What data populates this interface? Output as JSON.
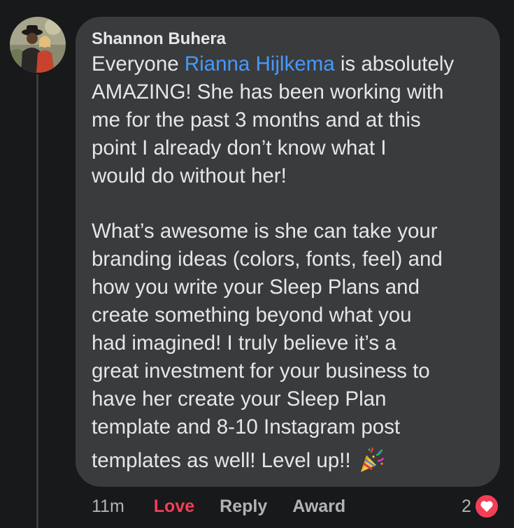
{
  "comment": {
    "author": "Shannon Buhera",
    "paragraph1": {
      "before_mention": "Everyone ",
      "mention": "Rianna Hijlkema",
      "after_mention": " is absolutely\nAMAZING! She has been working with\nme for the past 3 months and at this\npoint I already don’t know what I\nwould do without her!"
    },
    "paragraph2": "What’s awesome is she can take your\nbranding ideas (colors, fonts, feel) and\nhow you write your Sleep Plans and\ncreate something beyond what you\nhad imagined! I truly believe it’s a\ngreat investment for your business to\nhave her create your Sleep Plan\ntemplate and 8-10 Instagram post",
    "last_line": "templates as well! Level up!!",
    "emoji": "party-popper-icon"
  },
  "actions": {
    "timestamp": "11m",
    "love_label": "Love",
    "reply_label": "Reply",
    "award_label": "Award"
  },
  "reactions": {
    "count": "2",
    "icon": "heart-icon"
  },
  "colors": {
    "background": "#18191a",
    "bubble": "#3a3b3c",
    "text": "#e4e6eb",
    "mention": "#4599ff",
    "love": "#f33e58",
    "secondary": "#b0b3b8"
  }
}
